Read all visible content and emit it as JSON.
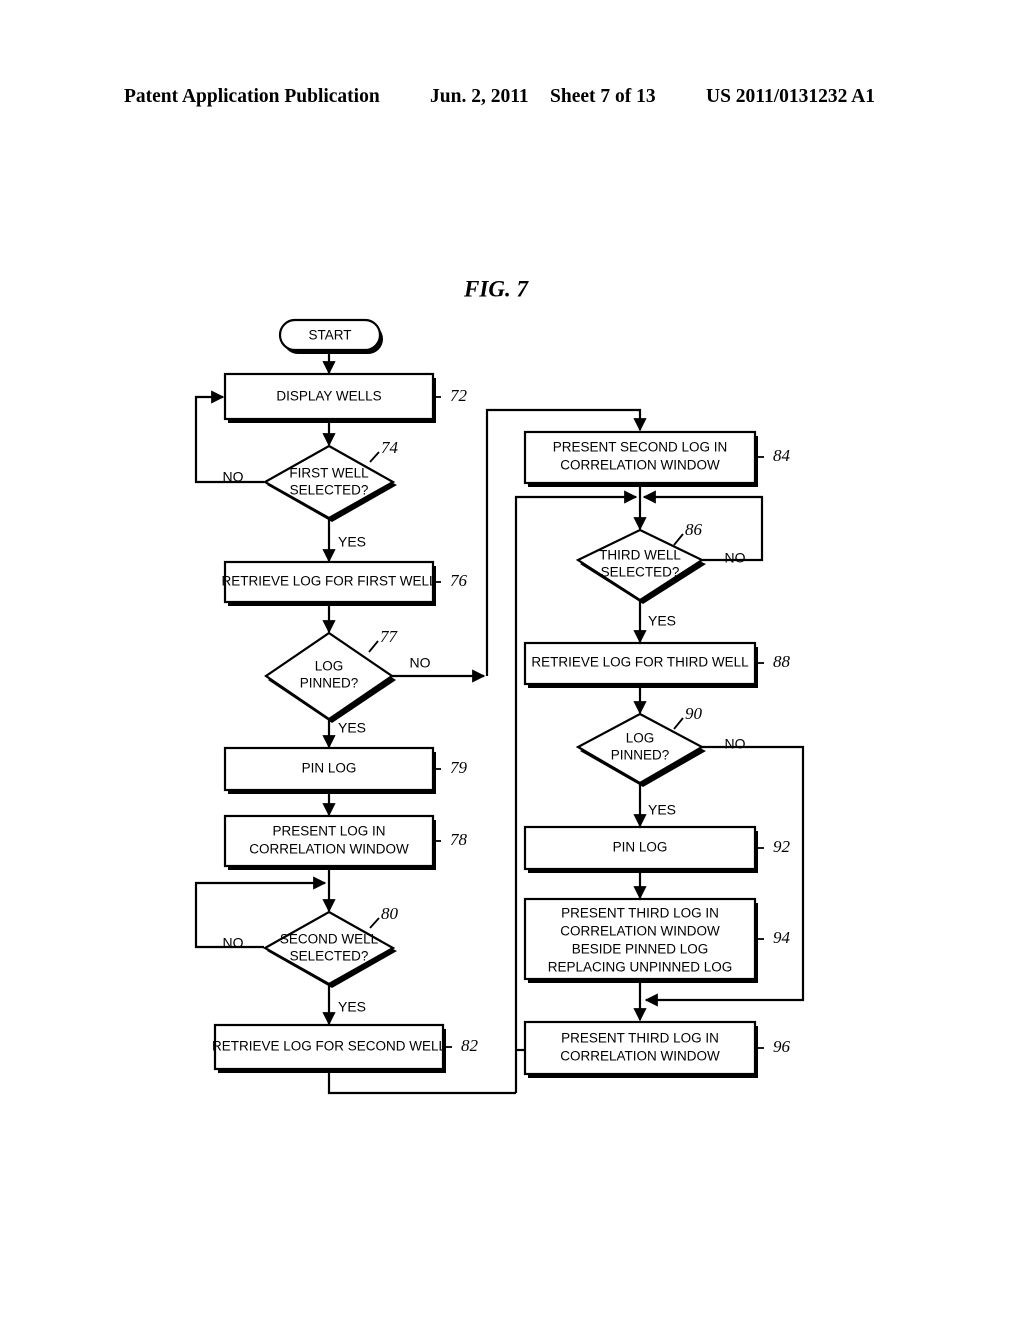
{
  "header": {
    "title": "Patent Application Publication",
    "date": "Jun. 2, 2011",
    "sheet": "Sheet 7 of 13",
    "publication_number": "US 2011/0131232 A1"
  },
  "figure": {
    "title": "FIG. 7",
    "type": "flowchart"
  },
  "nodes": {
    "start": {
      "label": "START",
      "shape": "terminator"
    },
    "n72": {
      "label": "DISPLAY WELLS",
      "ref": "72",
      "shape": "process"
    },
    "n74": {
      "label_line1": "FIRST WELL",
      "label_line2": "SELECTED?",
      "ref": "74",
      "shape": "decision"
    },
    "n76": {
      "label": "RETRIEVE LOG FOR FIRST WELL",
      "ref": "76",
      "shape": "process"
    },
    "n77": {
      "label_line1": "LOG",
      "label_line2": "PINNED?",
      "ref": "77",
      "shape": "decision"
    },
    "n79": {
      "label": "PIN LOG",
      "ref": "79",
      "shape": "process"
    },
    "n78": {
      "label_line1": "PRESENT LOG IN",
      "label_line2": "CORRELATION WINDOW",
      "ref": "78",
      "shape": "process"
    },
    "n80": {
      "label_line1": "SECOND WELL",
      "label_line2": "SELECTED?",
      "ref": "80",
      "shape": "decision"
    },
    "n82": {
      "label": "RETRIEVE LOG FOR SECOND WELL",
      "ref": "82",
      "shape": "process"
    },
    "n84": {
      "label_line1": "PRESENT SECOND LOG IN",
      "label_line2": "CORRELATION WINDOW",
      "ref": "84",
      "shape": "process"
    },
    "n86": {
      "label_line1": "THIRD WELL",
      "label_line2": "SELECTED?",
      "ref": "86",
      "shape": "decision"
    },
    "n88": {
      "label": "RETRIEVE LOG FOR THIRD WELL",
      "ref": "88",
      "shape": "process"
    },
    "n90": {
      "label_line1": "LOG",
      "label_line2": "PINNED?",
      "ref": "90",
      "shape": "decision"
    },
    "n92": {
      "label": "PIN LOG",
      "ref": "92",
      "shape": "process"
    },
    "n94": {
      "label_line1": "PRESENT THIRD LOG IN",
      "label_line2": "CORRELATION WINDOW",
      "label_line3": "BESIDE PINNED LOG",
      "label_line4": "REPLACING UNPINNED LOG",
      "ref": "94",
      "shape": "process"
    },
    "n96": {
      "label_line1": "PRESENT THIRD LOG IN",
      "label_line2": "CORRELATION WINDOW",
      "ref": "96",
      "shape": "process"
    }
  },
  "edge_labels": {
    "n74_no": "NO",
    "n74_yes": "YES",
    "n77_no": "NO",
    "n77_yes": "YES",
    "n80_no": "NO",
    "n80_yes": "YES",
    "n86_no": "NO",
    "n86_yes": "YES",
    "n90_no": "NO",
    "n90_yes": "YES"
  },
  "colors": {
    "ink": "#000000",
    "paper": "#ffffff"
  }
}
